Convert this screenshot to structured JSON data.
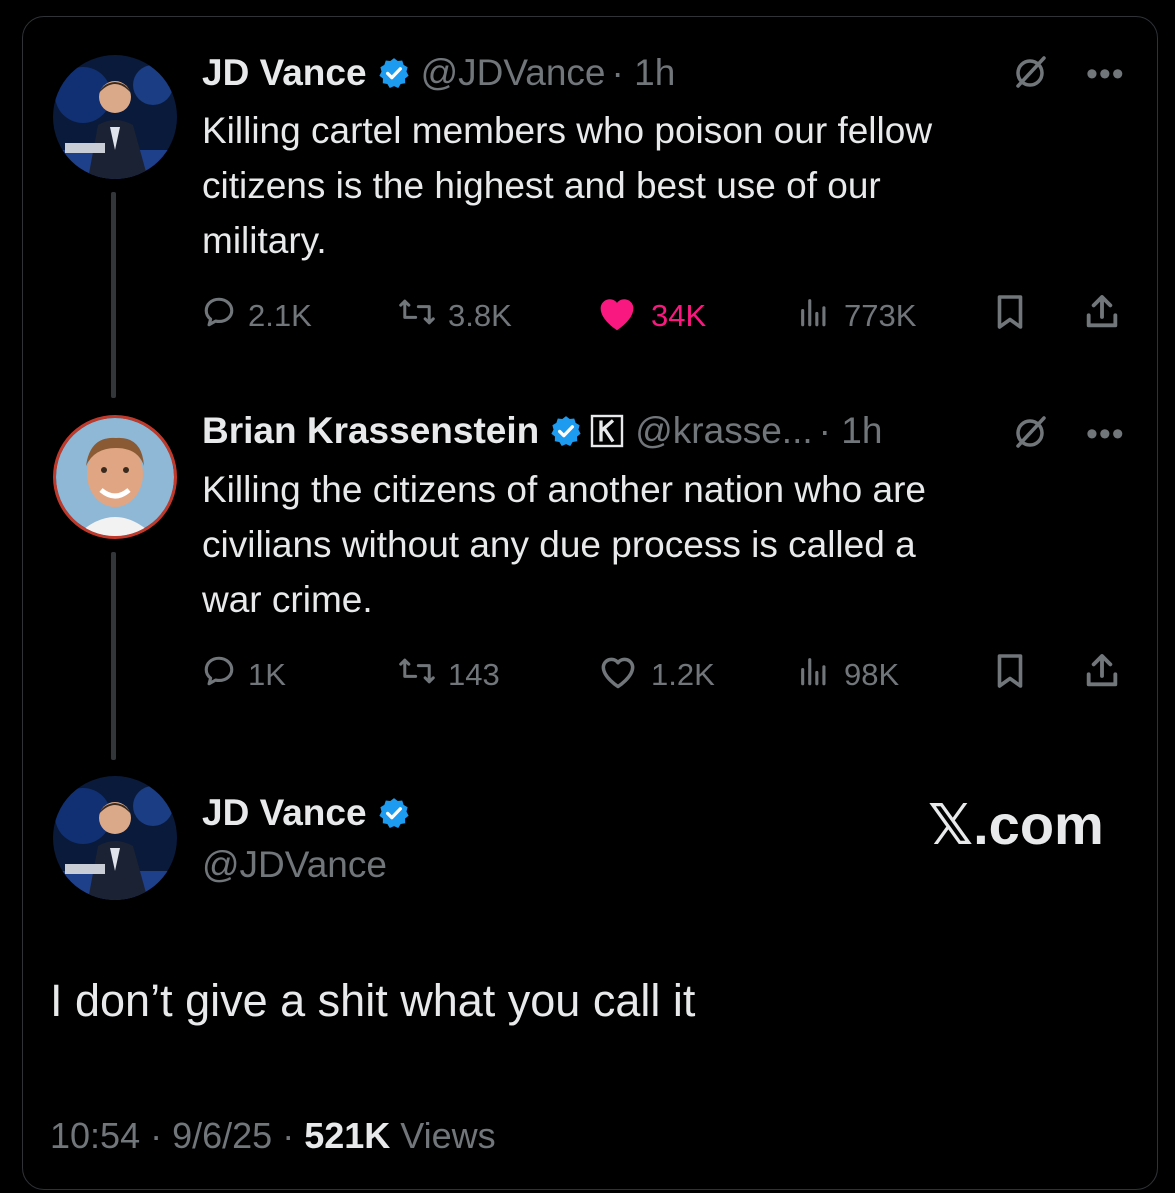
{
  "colors": {
    "accent": "#1d9bf0",
    "like_active": "#f91880",
    "muted": "#71767b",
    "text": "#e7e9ea"
  },
  "tweet1": {
    "name": "JD Vance",
    "handle": "@JDVance",
    "time": "· 1h",
    "text_lines": [
      "Killing cartel members who poison our fellow",
      "citizens is the highest and best use of our",
      "military."
    ],
    "replies": "2.1K",
    "reposts": "3.8K",
    "likes": "34K",
    "views": "773K"
  },
  "tweet2": {
    "name": "Brian Krassenstein",
    "handle": "@krasse...",
    "time": "· 1h",
    "text_lines": [
      "Killing the citizens of another nation who are",
      "civilians without any due process is called a",
      "war crime."
    ],
    "replies": "1K",
    "reposts": "143",
    "likes": "1.2K",
    "views": "98K"
  },
  "tweet3": {
    "name": "JD Vance",
    "handle": "@JDVance",
    "text": "I don’t give a shit what you call it",
    "time": "10:54",
    "date": "9/6/25",
    "views_count": "521K",
    "views_label": "Views"
  },
  "watermark": "𝕏.com",
  "icons": [
    "verified-badge-icon",
    "grok-icon",
    "more-icon",
    "reply-icon",
    "repost-icon",
    "like-icon",
    "views-icon",
    "bookmark-icon",
    "share-icon",
    "affiliate-k-icon"
  ]
}
